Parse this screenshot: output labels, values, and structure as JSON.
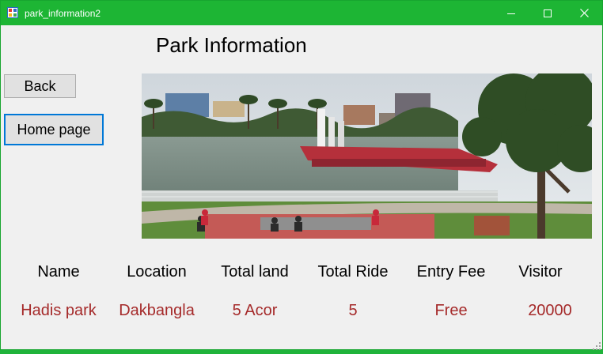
{
  "window": {
    "title": "park_information2",
    "accent": "#1db534",
    "icons": [
      "app-icon",
      "minimize-icon",
      "maximize-icon",
      "close-icon"
    ]
  },
  "page": {
    "heading": "Park Information"
  },
  "buttons": {
    "back": "Back",
    "home": "Home page"
  },
  "photo": {
    "subject": "park lake photo"
  },
  "table": {
    "headers": [
      "Name",
      "Location",
      "Total land",
      "Total Ride",
      "Entry Fee",
      "Visitor"
    ],
    "values": [
      "Hadis park",
      "Dakbangla",
      "5 Acor",
      "5",
      "Free",
      "20000"
    ],
    "value_color": "#a52a2a"
  }
}
